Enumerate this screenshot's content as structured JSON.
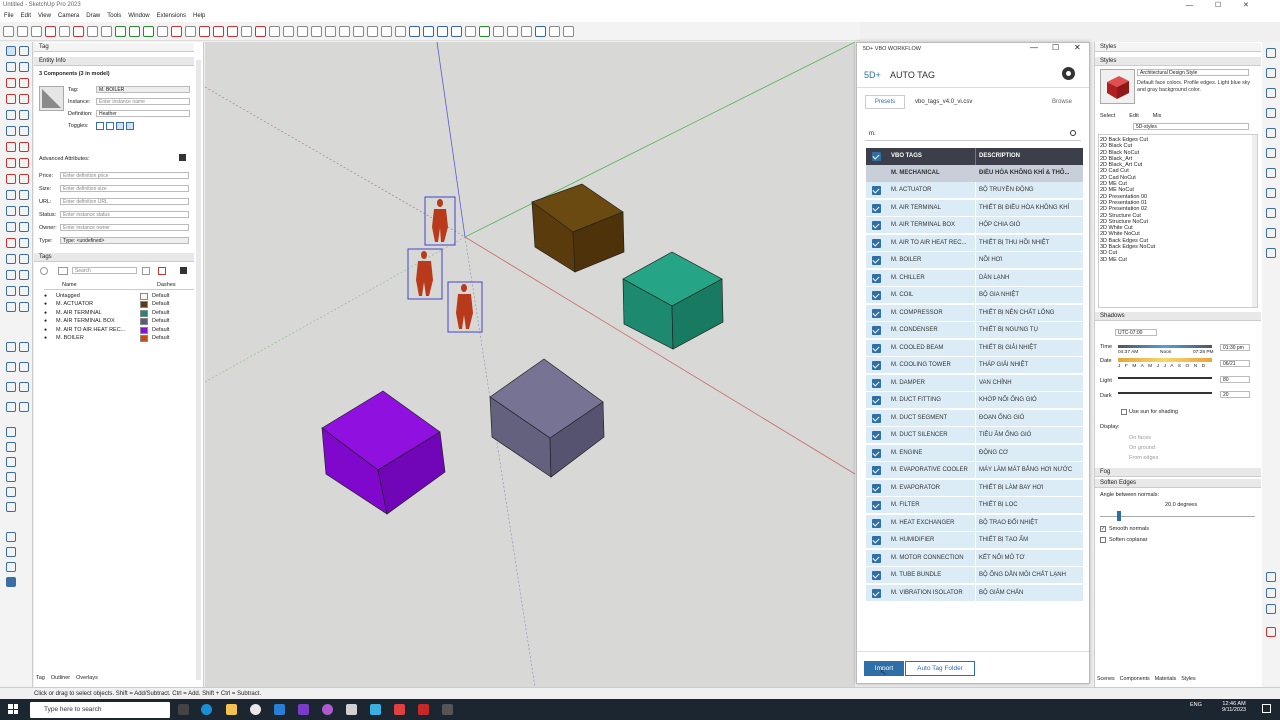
{
  "window": {
    "title": "Untitled - SketchUp Pro 2023"
  },
  "menu": [
    "File",
    "Edit",
    "View",
    "Camera",
    "Draw",
    "Tools",
    "Window",
    "Extensions",
    "Help"
  ],
  "left_tray": {
    "tray_title": "Tag",
    "entity_info": {
      "header": "Entity Info",
      "summary": "3 Components (3 in model)",
      "tag_label": "Tag:",
      "tag_value": "M. BOILER",
      "instance_label": "Instance:",
      "instance_placeholder": "Enter instance name",
      "definition_label": "Definition:",
      "definition_value": "Heather",
      "toggles_label": "Toggles:",
      "advanced_label": "Advanced Attributes:",
      "price_label": "Price:",
      "price_placeholder": "Enter definition price",
      "size_label": "Size:",
      "size_placeholder": "Enter definition size",
      "url_label": "URL:",
      "url_placeholder": "Enter definition URL",
      "status_label": "Status:",
      "status_placeholder": "Enter instance status",
      "owner_label": "Owner:",
      "owner_placeholder": "Enter instance owner",
      "type_label": "Type:",
      "type_value": "Type: <undefined>"
    },
    "tags": {
      "header": "Tags",
      "search_placeholder": "Search",
      "col_name": "Name",
      "col_dashes": "Dashes",
      "rows": [
        {
          "name": "Untagged",
          "color": "#f7f7f7",
          "dash": "Default"
        },
        {
          "name": "M. ACTUATOR",
          "color": "#5c3d12",
          "dash": "Default"
        },
        {
          "name": "M. AIR TERMINAL",
          "color": "#1f8a6f",
          "dash": "Default"
        },
        {
          "name": "M. AIR TERMINAL BOX",
          "color": "#5c5a78",
          "dash": "Default"
        },
        {
          "name": "M. AIR TO AIR HEAT REC...",
          "color": "#8a10d8",
          "dash": "Default"
        },
        {
          "name": "M. BOILER",
          "color": "#c84a14",
          "dash": "Default"
        }
      ]
    },
    "bottom_tabs": [
      "Tag",
      "Outliner",
      "Overlays"
    ]
  },
  "vbo": {
    "window_title": "5D+ VBO WORKFLOW",
    "brand": "5D+",
    "title": "AUTO TAG",
    "presets_label": "Presets",
    "file_name": "vbo_tags_v4.0_vi.csv",
    "browse_label": "Browse",
    "search_value": "m.",
    "col_tags": "VBO TAGS",
    "col_desc": "DESCRIPTION",
    "group": {
      "name": "M. MECHANICAL",
      "desc": "ĐIỀU HÒA KHÔNG KHÍ & THÔ..."
    },
    "rows": [
      {
        "name": "M. ACTUATOR",
        "desc": "BỘ TRUYỀN ĐỘNG"
      },
      {
        "name": "M. AIR TERMINAL",
        "desc": "THIẾT BỊ ĐIỀU HÒA KHÔNG KHÍ"
      },
      {
        "name": "M. AIR TERMINAL BOX",
        "desc": "HỘP CHIA GIÓ"
      },
      {
        "name": "M. AIR TO AIR HEAT REC...",
        "desc": "THIẾT BỊ THU HỒI NHIỆT"
      },
      {
        "name": "M. BOILER",
        "desc": "NỒI HƠI"
      },
      {
        "name": "M. CHILLER",
        "desc": "DÀN LẠNH"
      },
      {
        "name": "M. COIL",
        "desc": "BỘ GIA NHIỆT"
      },
      {
        "name": "M. COMPRESSOR",
        "desc": "THIẾT BỊ NÉN CHẤT LỎNG"
      },
      {
        "name": "M. CONDENSER",
        "desc": "THIẾT BỊ NGƯNG TỤ"
      },
      {
        "name": "M. COOLED BEAM",
        "desc": "THIẾT BỊ GIẢI NHIỆT"
      },
      {
        "name": "M. COOLING TOWER",
        "desc": "THÁP GIẢI NHIỆT"
      },
      {
        "name": "M. DAMPER",
        "desc": "VAN CHỈNH"
      },
      {
        "name": "M. DUCT FITTING",
        "desc": "KHỚP NỐI ỐNG GIÓ"
      },
      {
        "name": "M. DUCT SEGMENT",
        "desc": "ĐOẠN ỐNG GIÓ"
      },
      {
        "name": "M. DUCT SILENCER",
        "desc": "TIÊU ÂM ỐNG GIÓ"
      },
      {
        "name": "M. ENGINE",
        "desc": "ĐỘNG CƠ"
      },
      {
        "name": "M. EVAPORATIVE COOLER",
        "desc": "MÁY LÀM MÁT BẰNG HƠI NƯỚC"
      },
      {
        "name": "M. EVAPORATOR",
        "desc": "THIẾT BỊ LÀM BAY HƠI"
      },
      {
        "name": "M. FILTER",
        "desc": "THIẾT BỊ LỌC"
      },
      {
        "name": "M. HEAT EXCHANGER",
        "desc": "BỘ TRAO ĐỔI NHIỆT"
      },
      {
        "name": "M. HUMIDIFIER",
        "desc": "THIẾT BỊ TẠO ẨM"
      },
      {
        "name": "M. MOTOR CONNECTION",
        "desc": "KẾT NỐI MÔ TƠ"
      },
      {
        "name": "M. TUBE BUNDLE",
        "desc": "BỘ ỐNG DẪN MÔI CHẤT LẠNH"
      },
      {
        "name": "M. VIBRATION ISOLATOR",
        "desc": "BỘ GIẢM CHẤN"
      }
    ],
    "import_label": "Import",
    "folder_label": "Auto Tag Folder"
  },
  "styles": {
    "header": "Styles",
    "sub_header": "Styles",
    "style_name": "Architectural Design Style",
    "style_desc": "Default face colors. Profile edges. Light blue sky and gray background color.",
    "tabs": [
      "Select",
      "Edit",
      "Mix"
    ],
    "collection": "5D-styles",
    "list": [
      "2D Back Edges Cut",
      "2D Black Cut",
      "2D Black NoCut",
      "2D Black_Art",
      "2D Black_Art Cut",
      "2D Cad Cut",
      "2D Cad NoCut",
      "2D ME Cut",
      "2D ME NoCut",
      "2D Presentation 00",
      "2D Presentation 01",
      "2D Presentation 02",
      "2D Structure Cut",
      "2D Structure NoCut",
      "2D White Cut",
      "2D White NoCut",
      "3D Back Edges Cut",
      "3D Back Edges NoCut",
      "3D Cut",
      "3D ME Cut"
    ],
    "shadows": {
      "header": "Shadows",
      "tz": "UTC-07:00",
      "time_label": "Time",
      "sunrise": "04:37 AM",
      "noon": "Noon",
      "sunset": "07:28 PM",
      "time_value": "01:30 pm",
      "date_label": "Date",
      "months": "J F M A M J J A S O N D",
      "date_value": "06/21",
      "light_label": "Light",
      "light_value": "80",
      "dark_label": "Dark",
      "dark_value": "20",
      "use_sun": "Use sun for shading",
      "display_label": "Display:",
      "on_faces": "On faces",
      "on_ground": "On ground",
      "from_edges": "From edges"
    },
    "fog_header": "Fog",
    "soften": {
      "header": "Soften Edges",
      "angle_label": "Angle between normals:",
      "angle_value": "20.0  degrees",
      "smooth": "Smooth normals",
      "coplanar": "Soften coplanar"
    },
    "bottom_tabs": [
      "Scenes",
      "Components",
      "Materials",
      "Styles"
    ]
  },
  "status": "Click or drag to select objects. Shift = Add/Subtract. Ctrl = Add. Shift + Ctrl = Subtract.",
  "taskbar": {
    "search_placeholder": "Type here to search",
    "time": "12:46 AM",
    "date": "9/11/2023",
    "lang": "ENG"
  },
  "colors": {
    "accent": "#2f6fa8",
    "header_dark": "#3c3f4a",
    "row_bg": "#dcecf6"
  }
}
